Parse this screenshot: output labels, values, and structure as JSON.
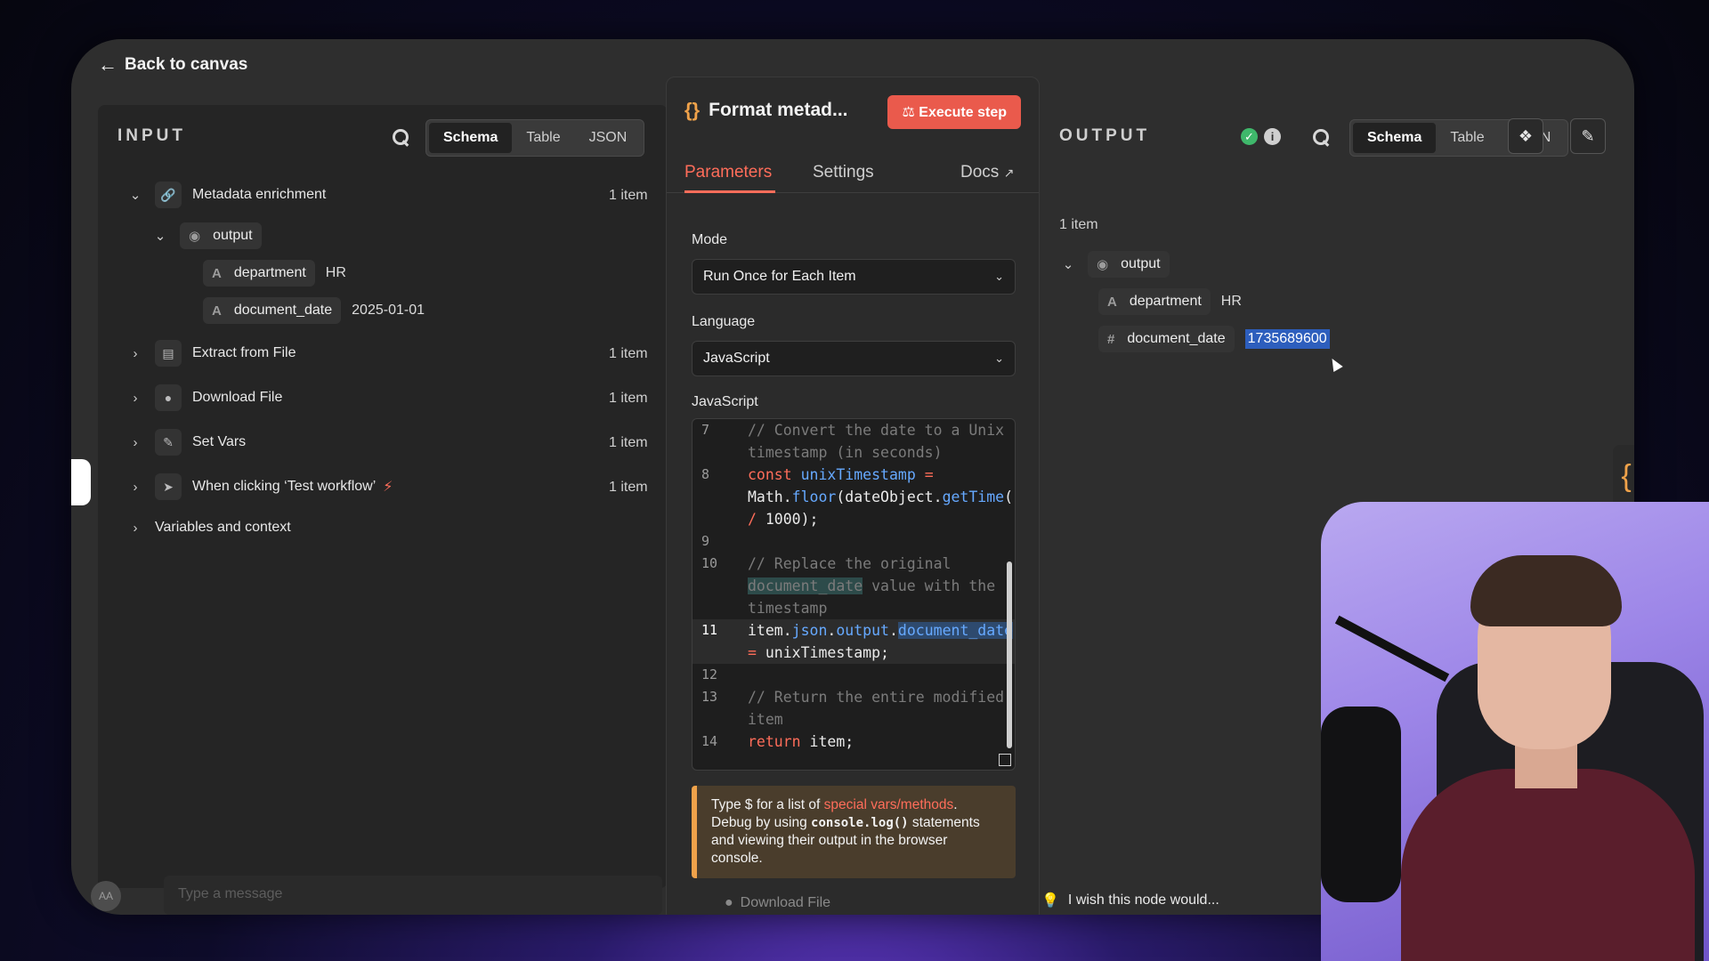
{
  "back_label": "Back to canvas",
  "input": {
    "title": "INPUT",
    "view_tabs": [
      "Schema",
      "Table",
      "JSON"
    ],
    "nodes": [
      {
        "name": "Metadata enrichment",
        "count": "1 item"
      },
      {
        "name": "Extract from File",
        "count": "1 item"
      },
      {
        "name": "Download File",
        "count": "1 item"
      },
      {
        "name": "Set Vars",
        "count": "1 item"
      },
      {
        "name": "When clicking ‘Test workflow’",
        "count": "1 item"
      }
    ],
    "output_label": "output",
    "fields": [
      {
        "type": "A",
        "name": "department",
        "value": "HR"
      },
      {
        "type": "A",
        "name": "document_date",
        "value": "2025-01-01"
      }
    ],
    "variables_label": "Variables and context"
  },
  "node": {
    "title": "Format metad...",
    "execute_label": "Execute step",
    "tabs": {
      "parameters": "Parameters",
      "settings": "Settings",
      "docs": "Docs"
    },
    "mode_label": "Mode",
    "mode_value": "Run Once for Each Item",
    "language_label": "Language",
    "language_value": "JavaScript",
    "code_label": "JavaScript",
    "line_numbers": [
      "7",
      "8",
      "9",
      "10",
      "11",
      "12",
      "13",
      "14"
    ],
    "tip": {
      "part1": "Type $ for a list of ",
      "link": "special vars/methods",
      "part2": ". Debug by using ",
      "code": "console.log()",
      "part3": " statements and viewing their output in the browser console."
    }
  },
  "output": {
    "title": "OUTPUT",
    "view_tabs": [
      "Schema",
      "Table",
      "JSON"
    ],
    "count": "1 item",
    "output_label": "output",
    "fields": [
      {
        "type": "A",
        "name": "department",
        "value": "HR"
      },
      {
        "type": "#",
        "name": "document_date",
        "value": "1735689600"
      }
    ]
  },
  "footer": {
    "wish": "I wish this node would...",
    "message_placeholder": "Type a message",
    "avatar": "AA",
    "download_file": "Download File"
  },
  "colors": {
    "accent": "#ff6d5a",
    "execute": "#ea5a4c",
    "success": "#3fb86b",
    "brace": "#f0a24a"
  }
}
